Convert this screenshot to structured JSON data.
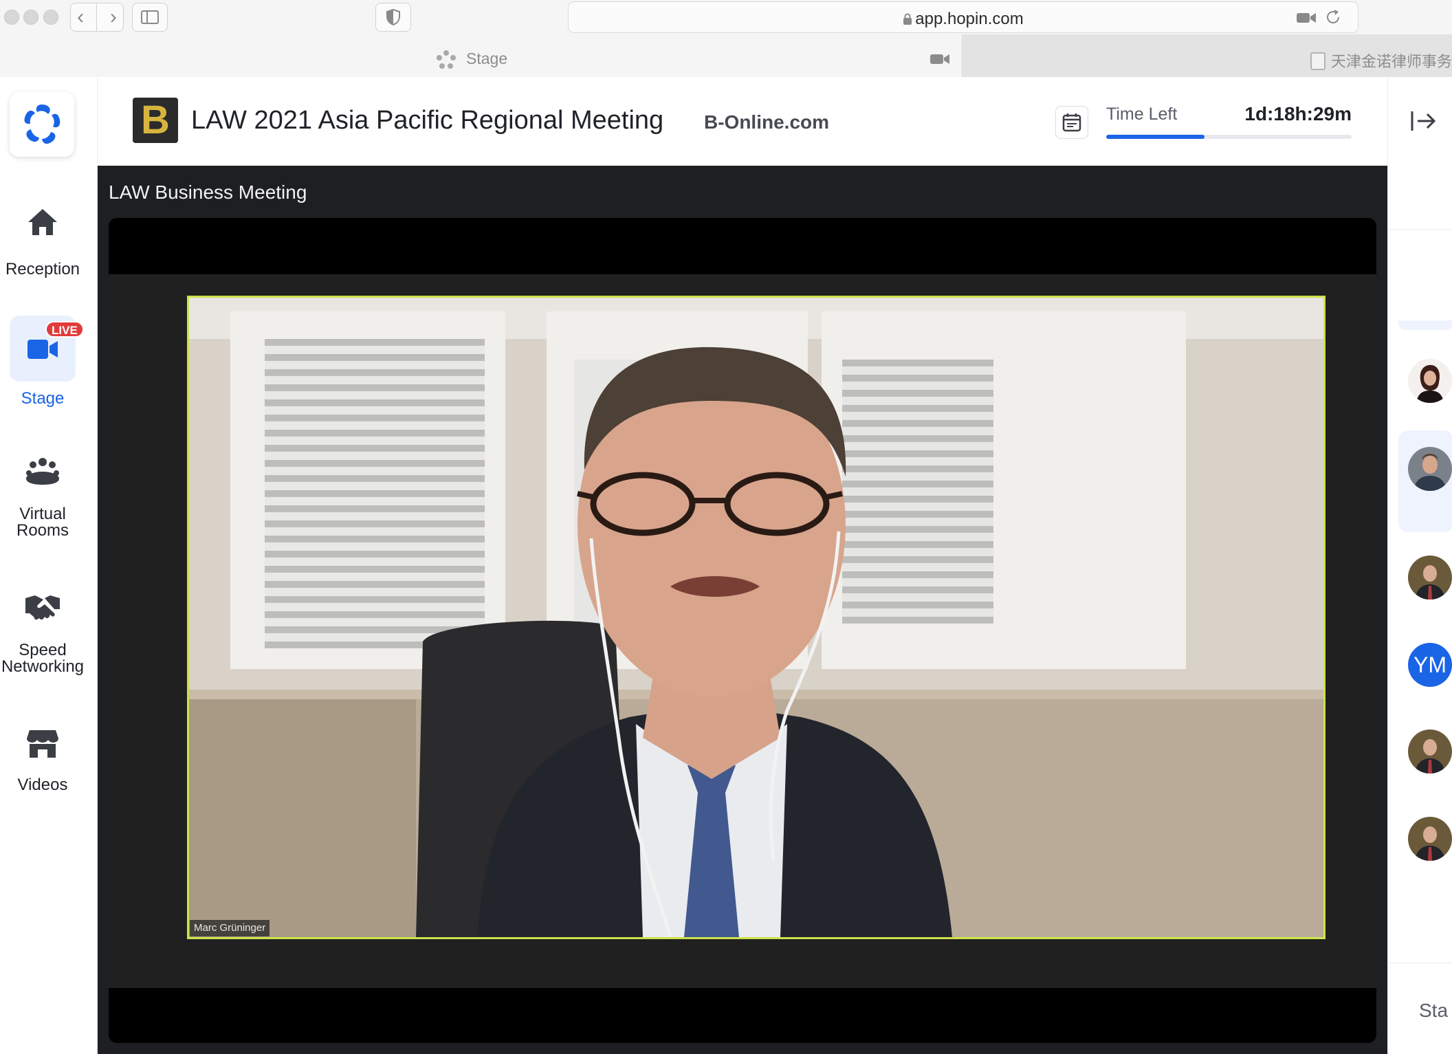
{
  "browser": {
    "url": "app.hopin.com",
    "active_tab_title": "Stage",
    "other_tab_title": "天津金诺律师事务"
  },
  "sidebar": {
    "items": [
      {
        "label": "Reception",
        "icon": "home-icon"
      },
      {
        "label": "Stage",
        "icon": "video-camera-icon",
        "badge": "LIVE",
        "active": true
      },
      {
        "label": "Virtual\nRooms",
        "icon": "people-group-icon"
      },
      {
        "label": "Speed\nNetworking",
        "icon": "handshake-icon"
      },
      {
        "label": "Videos",
        "icon": "storefront-icon"
      }
    ]
  },
  "header": {
    "logo_letter": "B",
    "event_title": "LAW 2021 Asia Pacific Regional Meeting",
    "organizer": "B-Online.com",
    "time_left_label": "Time Left",
    "time_left_value": "1d:18h:29m",
    "time_left_progress": 0.4
  },
  "stage": {
    "session_title": "LAW Business Meeting",
    "speaker_name_tag": "Marc Grüninger"
  },
  "right_panel": {
    "avatars": [
      {
        "type": "photo",
        "icon": "woman-avatar"
      },
      {
        "type": "photo",
        "icon": "man-avatar"
      },
      {
        "type": "photo",
        "icon": "man-avatar"
      },
      {
        "type": "initials",
        "initials": "YM"
      },
      {
        "type": "photo",
        "icon": "man-avatar"
      },
      {
        "type": "photo",
        "icon": "man-avatar"
      }
    ],
    "bottom_text": "Sta"
  },
  "colors": {
    "accent": "#1a64e6",
    "live": "#e23b3b",
    "stage_bg": "#1d1f22",
    "speaker_border": "#cde24a",
    "logo_gold": "#d7b43f"
  }
}
